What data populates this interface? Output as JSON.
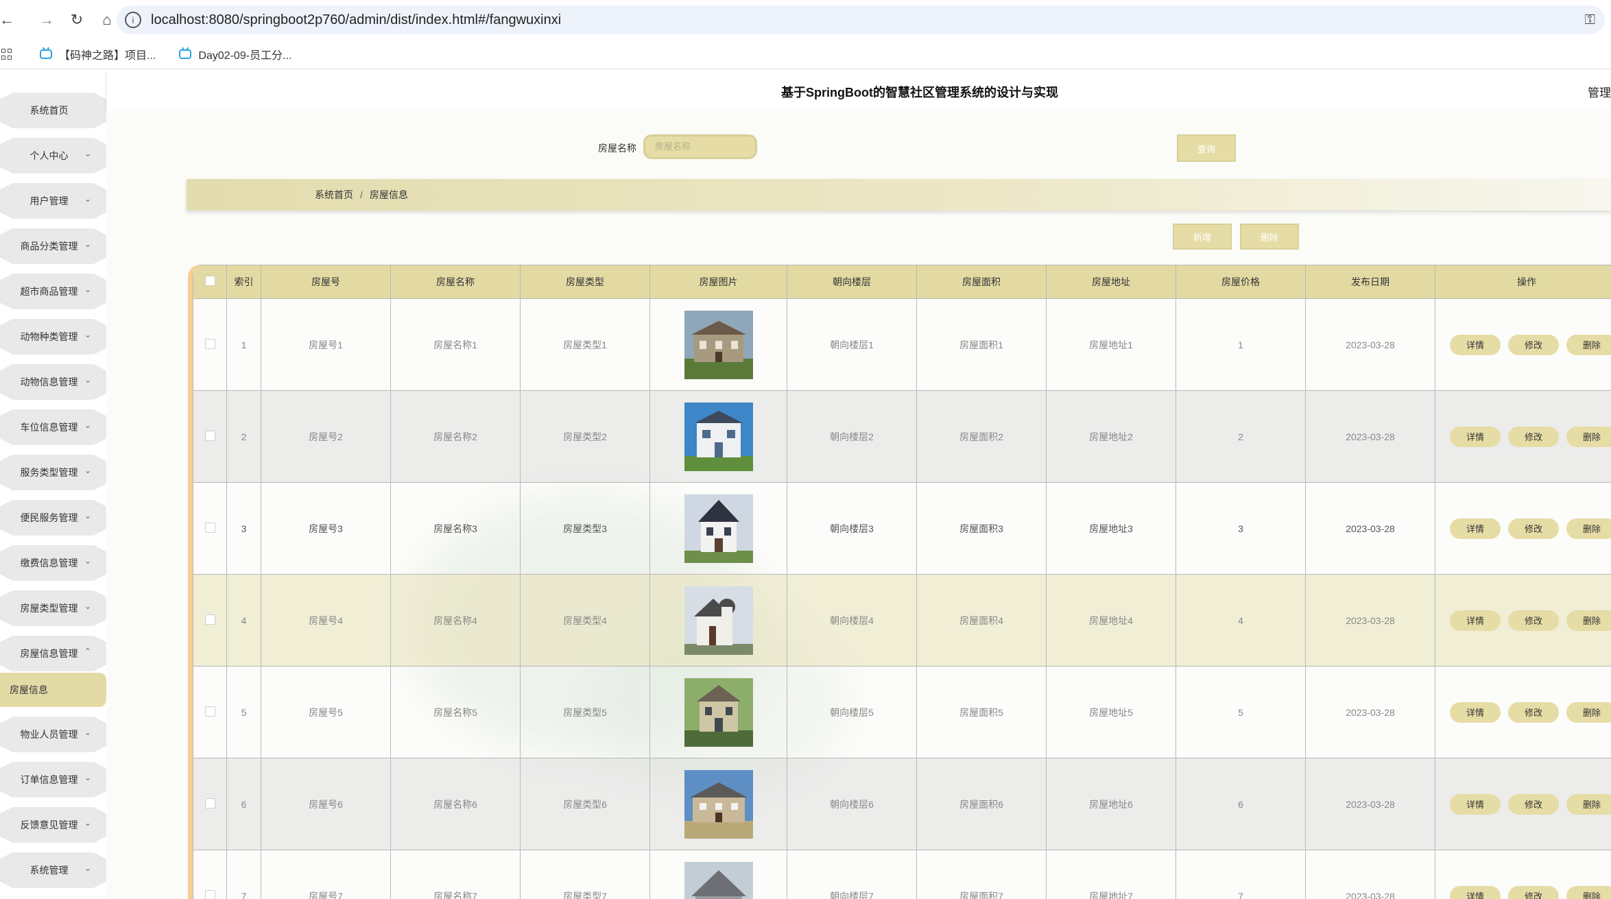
{
  "browser": {
    "url": "localhost:8080/springboot2p760/admin/dist/index.html#/fangwuxinxi",
    "bookmarks": [
      "【码神之路】项目...",
      "Day02-09-员工分..."
    ]
  },
  "header": {
    "title": "基于SpringBoot的智慧社区管理系统的设计与实现",
    "user": "管理"
  },
  "sidebar": {
    "items": [
      {
        "label": "系统首页",
        "chevron": ""
      },
      {
        "label": "个人中心",
        "chevron": "⌄"
      },
      {
        "label": "用户管理",
        "chevron": "⌄"
      },
      {
        "label": "商品分类管理",
        "chevron": "⌄"
      },
      {
        "label": "超市商品管理",
        "chevron": "⌄"
      },
      {
        "label": "动物种类管理",
        "chevron": "⌄"
      },
      {
        "label": "动物信息管理",
        "chevron": "⌄"
      },
      {
        "label": "车位信息管理",
        "chevron": "⌄"
      },
      {
        "label": "服务类型管理",
        "chevron": "⌄"
      },
      {
        "label": "便民服务管理",
        "chevron": "⌄"
      },
      {
        "label": "缴费信息管理",
        "chevron": "⌄"
      },
      {
        "label": "房屋类型管理",
        "chevron": "⌄"
      },
      {
        "label": "房屋信息管理",
        "chevron": "⌃"
      },
      {
        "label": "物业人员管理",
        "chevron": "⌄"
      },
      {
        "label": "订单信息管理",
        "chevron": "⌄"
      },
      {
        "label": "反馈意见管理",
        "chevron": "⌄"
      },
      {
        "label": "系统管理",
        "chevron": "⌄"
      }
    ],
    "active_sub": "房屋信息"
  },
  "search": {
    "label": "房屋名称",
    "placeholder": "房屋名称",
    "button": "查询"
  },
  "breadcrumb": {
    "home": "系统首页",
    "separator": "/",
    "current": "房屋信息"
  },
  "actions": {
    "add": "新增",
    "delete": "删除"
  },
  "table": {
    "headers": [
      "索引",
      "房屋号",
      "房屋名称",
      "房屋类型",
      "房屋图片",
      "朝向楼层",
      "房屋面积",
      "房屋地址",
      "房屋价格",
      "发布日期",
      "操作"
    ],
    "row_buttons": [
      "详情",
      "修改",
      "删除"
    ],
    "rows": [
      {
        "index": "1",
        "fangwuhao": "房屋号1",
        "name": "房屋名称1",
        "type": "房屋类型1",
        "floor": "朝向楼层1",
        "area": "房屋面积1",
        "address": "房屋地址1",
        "price": "1",
        "date": "2023-03-28"
      },
      {
        "index": "2",
        "fangwuhao": "房屋号2",
        "name": "房屋名称2",
        "type": "房屋类型2",
        "floor": "朝向楼层2",
        "area": "房屋面积2",
        "address": "房屋地址2",
        "price": "2",
        "date": "2023-03-28"
      },
      {
        "index": "3",
        "fangwuhao": "房屋号3",
        "name": "房屋名称3",
        "type": "房屋类型3",
        "floor": "朝向楼层3",
        "area": "房屋面积3",
        "address": "房屋地址3",
        "price": "3",
        "date": "2023-03-28"
      },
      {
        "index": "4",
        "fangwuhao": "房屋号4",
        "name": "房屋名称4",
        "type": "房屋类型4",
        "floor": "朝向楼层4",
        "area": "房屋面积4",
        "address": "房屋地址4",
        "price": "4",
        "date": "2023-03-28"
      },
      {
        "index": "5",
        "fangwuhao": "房屋号5",
        "name": "房屋名称5",
        "type": "房屋类型5",
        "floor": "朝向楼层5",
        "area": "房屋面积5",
        "address": "房屋地址5",
        "price": "5",
        "date": "2023-03-28"
      },
      {
        "index": "6",
        "fangwuhao": "房屋号6",
        "name": "房屋名称6",
        "type": "房屋类型6",
        "floor": "朝向楼层6",
        "area": "房屋面积6",
        "address": "房屋地址6",
        "price": "6",
        "date": "2023-03-28"
      },
      {
        "index": "7",
        "fangwuhao": "房屋号7",
        "name": "房屋名称7",
        "type": "房屋类型7",
        "floor": "朝向楼层7",
        "area": "房屋面积7",
        "address": "房屋地址7",
        "price": "7",
        "date": "2023-03-28"
      }
    ]
  },
  "colors": {
    "accent": "#e6dca5",
    "header_row": "#e3daa3",
    "active_menu": "#e3dba6",
    "table_border_accent": "#f6cd93"
  }
}
